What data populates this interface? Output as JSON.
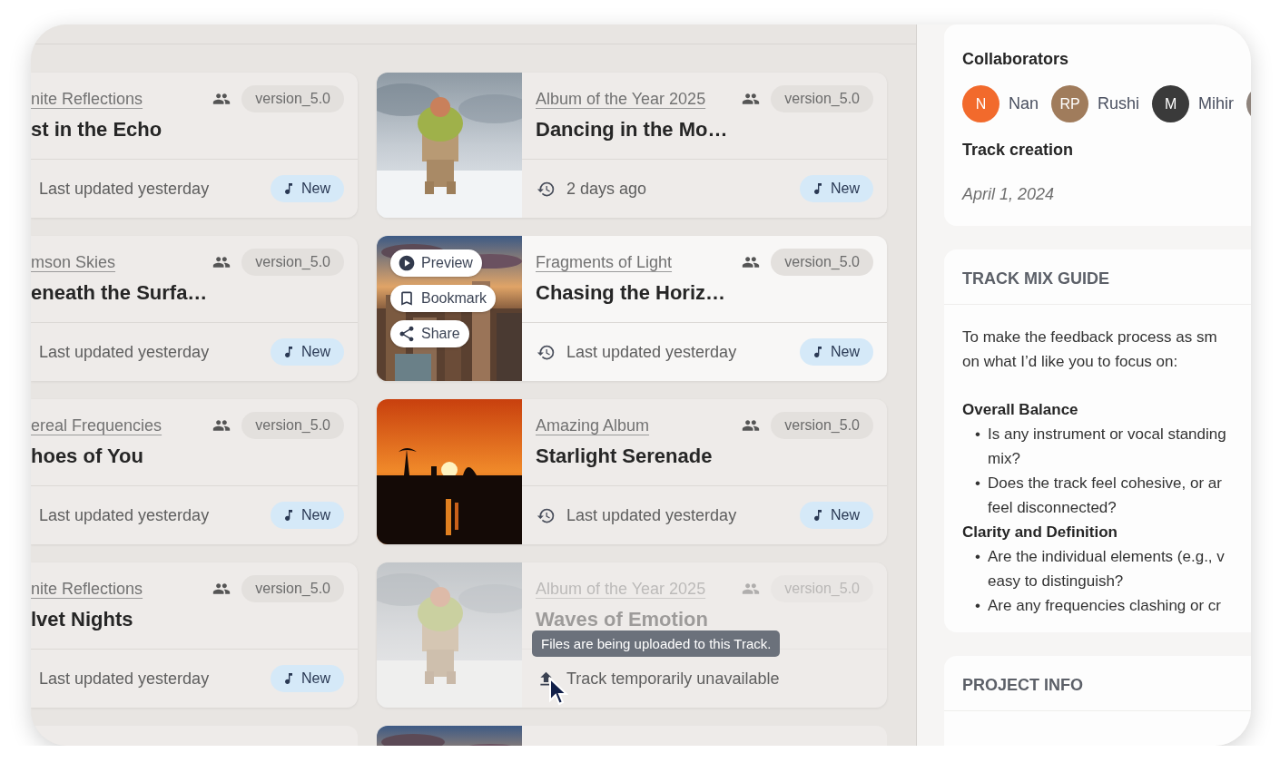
{
  "left_cards": [
    {
      "album": "nite Reflections",
      "title": "st in the Echo",
      "updated": "Last updated yesterday",
      "version": "version_5.0",
      "badge": "New"
    },
    {
      "album": "mson Skies",
      "title": "eneath the Surfa…",
      "updated": "Last updated yesterday",
      "version": "version_5.0",
      "badge": "New"
    },
    {
      "album": "ereal Frequencies",
      "title": "hoes of You",
      "updated": "Last updated yesterday",
      "version": "version_5.0",
      "badge": "New"
    },
    {
      "album": "nite Reflections",
      "title": "lvet Nights",
      "updated": "Last updated yesterday",
      "version": "version_5.0",
      "badge": "New"
    }
  ],
  "track_cards": [
    {
      "album": "Album of the Year 2025",
      "title": "Dancing in the Mo…",
      "updated": "2 days ago",
      "version": "version_5.0",
      "badge": "New",
      "hovered": false,
      "uploading": false
    },
    {
      "album": "Fragments of Light",
      "title": "Chasing the Horiz…",
      "updated": "Last updated yesterday",
      "version": "version_5.0",
      "badge": "New",
      "hovered": true,
      "uploading": false,
      "actions": [
        "Preview",
        "Bookmark",
        "Share"
      ]
    },
    {
      "album": "Amazing Album",
      "title": "Starlight Serenade",
      "updated": "Last updated yesterday",
      "version": "version_5.0",
      "badge": "New",
      "hovered": false,
      "uploading": false
    },
    {
      "album": "Album of the Year 2025",
      "title": "Waves of Emotion",
      "updated": "Track temporarily unavailable",
      "version": "version_5.0",
      "hovered": false,
      "uploading": true,
      "tooltip": "Files are being uploaded to this Track."
    }
  ],
  "side_panel": {
    "collaborators": {
      "title": "Collaborators",
      "people": [
        {
          "initials": "N",
          "name": "Nan",
          "color": "#f26a2c"
        },
        {
          "initials": "RP",
          "name": "Rushi",
          "color": "#a07c5c"
        },
        {
          "initials": "M",
          "name": "Mihir",
          "color": "#3a3a3a"
        },
        {
          "color": "#8e837c"
        }
      ]
    },
    "creation": {
      "title": "Track creation",
      "date": "April 1, 2024"
    },
    "mix_guide": {
      "title": "TRACK MIX GUIDE",
      "intro": [
        "To make the feedback process as sm",
        "on what I’d like you to focus on:"
      ],
      "sections": [
        {
          "heading": "Overall Balance",
          "items": [
            {
              "marker": "•",
              "lines": [
                "Is any instrument or vocal standing",
                "mix?"
              ]
            },
            {
              "marker": "•",
              "lines": [
                "Does the track feel cohesive, or ar",
                "feel disconnected?"
              ]
            }
          ]
        },
        {
          "heading": "Clarity and Definition",
          "items": [
            {
              "marker": "•",
              "lines": [
                "Are the individual elements (e.g., v",
                "easy to distinguish?"
              ]
            },
            {
              "marker": "•",
              "lines": [
                "Are any frequencies clashing or cr"
              ]
            }
          ]
        }
      ]
    },
    "project_info": {
      "title": "PROJECT INFO"
    }
  }
}
